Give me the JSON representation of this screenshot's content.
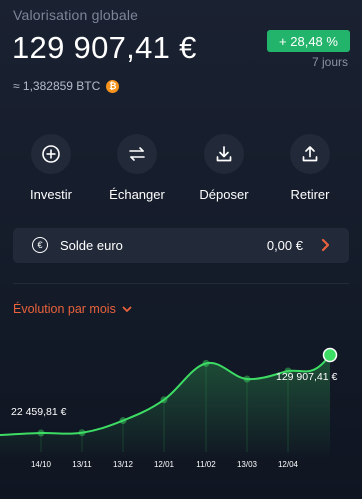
{
  "header": {
    "title": "Valorisation globale",
    "amount": "129 907,41 €",
    "change": "+ 28,48 %",
    "period": "7 jours",
    "btc_value": "≈ 1,382859 BTC",
    "btc_icon_glyph": "₿",
    "accent_green": "#23b46b"
  },
  "actions": [
    {
      "label": "Investir",
      "icon": "plus-circle-icon"
    },
    {
      "label": "Échanger",
      "icon": "swap-arrows-icon"
    },
    {
      "label": "Déposer",
      "icon": "download-icon"
    },
    {
      "label": "Retirer",
      "icon": "upload-icon"
    }
  ],
  "euro_balance": {
    "icon_glyph": "€",
    "label": "Solde euro",
    "value": "0,00 €",
    "chevron_color": "#e8623c"
  },
  "evolution": {
    "label": "Évolution par mois",
    "accent_orange": "#e8623c"
  },
  "chart_data": {
    "type": "area",
    "x": [
      "14/10",
      "13/11",
      "13/12",
      "12/01",
      "11/02",
      "13/03",
      "12/04"
    ],
    "values": [
      22459.81,
      23000,
      44000,
      80000,
      143000,
      116000,
      129907.41
    ],
    "ylim": [
      0,
      180000
    ],
    "start_label": "22 459,81 €",
    "end_label": "129 907,41 €",
    "line_color": "#3ddc64",
    "grid": false
  }
}
